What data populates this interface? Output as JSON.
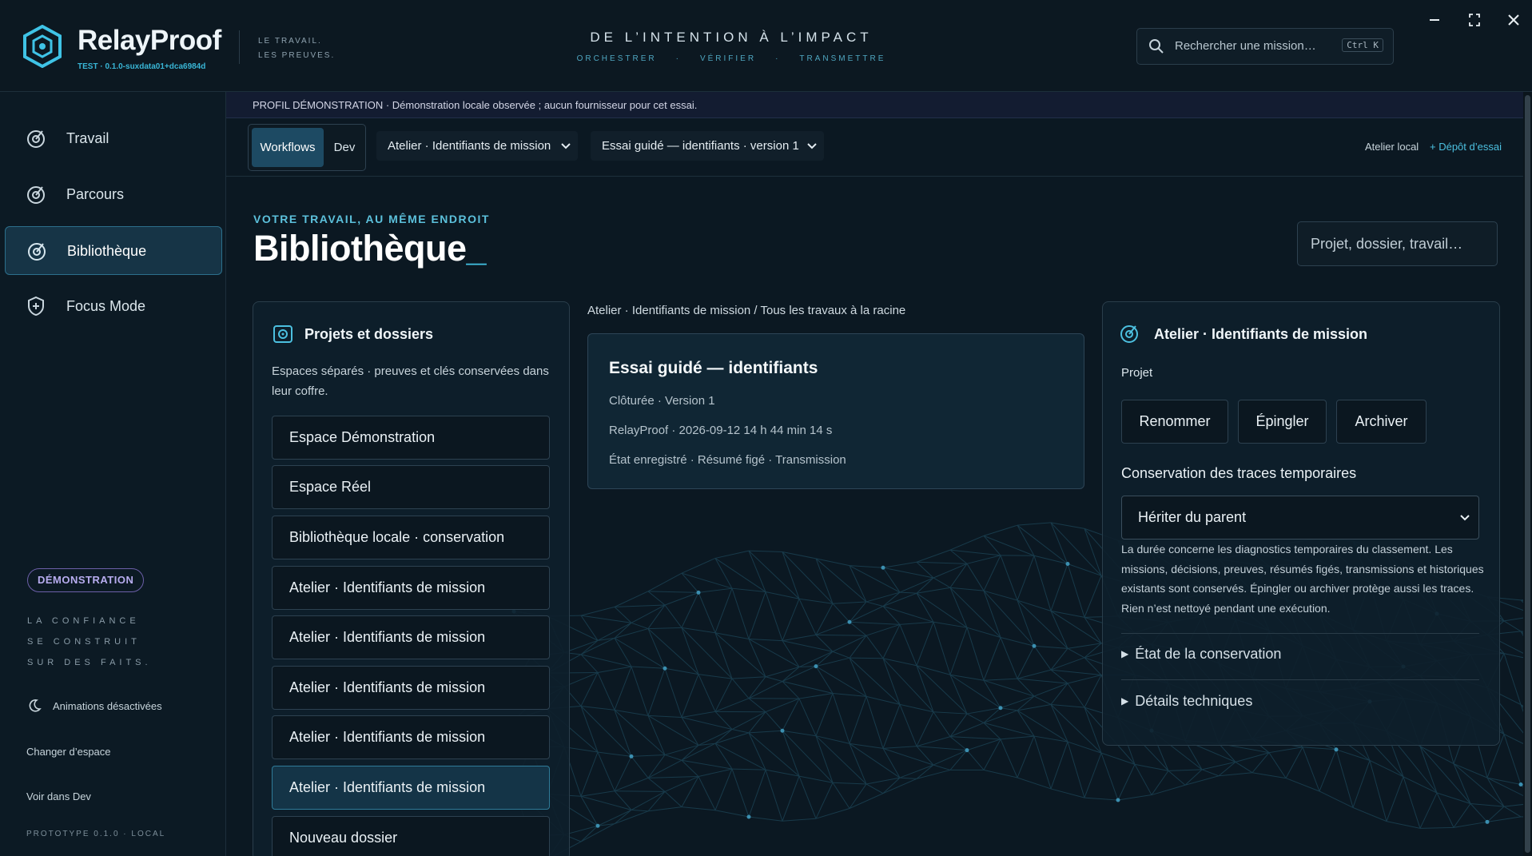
{
  "app": {
    "brand": "RelayProof",
    "build": "TEST · 0.1.0-suxdata01+dca6984d",
    "tagline_1": "LE TRAVAIL.",
    "tagline_2": "LES PREUVES.",
    "motto": "DE L’INTENTION À L’IMPACT",
    "motto_steps": [
      "ORCHESTRER",
      "VÉRIFIER",
      "TRANSMETTRE"
    ],
    "motto_sep": "·",
    "accent": "#3fc3e6"
  },
  "search": {
    "placeholder": "Rechercher une mission…",
    "shortcut": "Ctrl K"
  },
  "window_controls": [
    "minimize-icon",
    "maximize-icon",
    "close-icon"
  ],
  "sidebar": {
    "items": [
      {
        "label": "Travail",
        "icon": "target-icon",
        "active": false
      },
      {
        "label": "Parcours",
        "icon": "target-icon",
        "active": false
      },
      {
        "label": "Bibliothèque",
        "icon": "target-icon",
        "active": true
      },
      {
        "label": "Focus Mode",
        "icon": "shield-plus-icon",
        "active": false
      }
    ],
    "badge": "DÉMONSTRATION",
    "trust": [
      "LA CONFIANCE",
      "SE CONSTRUIT",
      "SUR DES FAITS."
    ],
    "animations_label": "Animations désactivées",
    "switch_space": "Changer d’espace",
    "view_in_dev": "Voir dans Dev",
    "prototype": "PROTOTYPE 0.1.0 · LOCAL"
  },
  "notice": "PROFIL DÉMONSTRATION · Démonstration locale observée ; aucun fournisseur pour cet essai.",
  "toolbar": {
    "tabs": [
      "Workflows",
      "Dev"
    ],
    "active_tab": "Workflows",
    "project_select": "Atelier · Identifiants de mission",
    "run_select": "Essai guidé — identifiants · version 1",
    "workspace": "Atelier local",
    "add_repo": "+ Dépôt d’essai"
  },
  "page": {
    "eyebrow": "VOTRE TRAVAIL, AU MÊME ENDROIT",
    "title": "Bibliothèque",
    "cursor": "_",
    "search_placeholder": "Projet, dossier, travail…"
  },
  "projects_panel": {
    "title": "Projets et dossiers",
    "description": "Espaces séparés · preuves et clés conservées dans leur coffre.",
    "folders": [
      "Espace Démonstration",
      "Espace Réel",
      "Bibliothèque locale · conservation",
      "Atelier · Identifiants de mission",
      "Atelier · Identifiants de mission",
      "Atelier · Identifiants de mission",
      "Atelier · Identifiants de mission",
      "Atelier · Identifiants de mission",
      "Nouveau dossier"
    ],
    "selected_index": 7
  },
  "center": {
    "breadcrumb": "Atelier · Identifiants de mission / Tous les travaux à la racine",
    "run": {
      "title": "Essai guidé — identifiants",
      "status": "Clôturée · Version 1",
      "meta": "RelayProof · 2026-09-12 14 h 44 min 14 s",
      "flags": "État enregistré · Résumé figé · Transmission"
    }
  },
  "details_panel": {
    "title": "Atelier · Identifiants de mission",
    "kind": "Projet",
    "actions": [
      "Renommer",
      "Épingler",
      "Archiver"
    ],
    "retention_label": "Conservation des traces temporaires",
    "retention_value": "Hériter du parent",
    "retention_note": "La durée concerne les diagnostics temporaires du classement. Les missions, décisions, preuves, résumés figés, transmissions et historiques existants sont conservés. Épingler ou archiver protège aussi les traces. Rien n’est nettoyé pendant une exécution.",
    "disclosures": [
      "État de la conservation",
      "Détails techniques"
    ]
  }
}
